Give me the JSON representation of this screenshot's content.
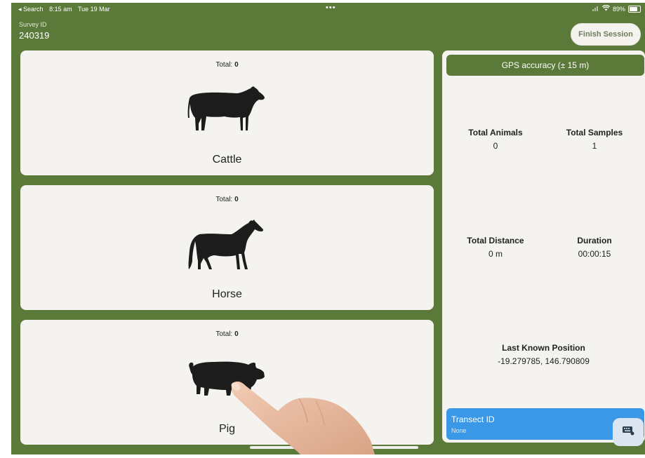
{
  "status_bar": {
    "back_label": "◂ Search",
    "time": "8:15 am",
    "date": "Tue 19 Mar",
    "dots": "•••",
    "battery": "89%"
  },
  "header": {
    "survey_label": "Survey ID",
    "survey_id": "240319",
    "finish_button": "Finish Session"
  },
  "animals": [
    {
      "name": "Cattle",
      "total_label": "Total:",
      "total": "0",
      "icon": "cow-icon"
    },
    {
      "name": "Horse",
      "total_label": "Total:",
      "total": "0",
      "icon": "horse-icon"
    },
    {
      "name": "Pig",
      "total_label": "Total:",
      "total": "0",
      "icon": "pig-icon"
    }
  ],
  "panel": {
    "gps": "GPS accuracy (± 15 m)",
    "total_animals_label": "Total Animals",
    "total_animals": "0",
    "total_samples_label": "Total Samples",
    "total_samples": "1",
    "total_distance_label": "Total Distance",
    "total_distance": "0 m",
    "duration_label": "Duration",
    "duration": "00:00:15",
    "last_position_label": "Last Known Position",
    "last_position": "-19.279785, 146.790809",
    "transect_label": "Transect ID",
    "transect_value": "None"
  },
  "colors": {
    "brand_green": "#5b7a3a",
    "card_bg": "#f4f3ef",
    "transect_blue": "#3a98e6"
  }
}
